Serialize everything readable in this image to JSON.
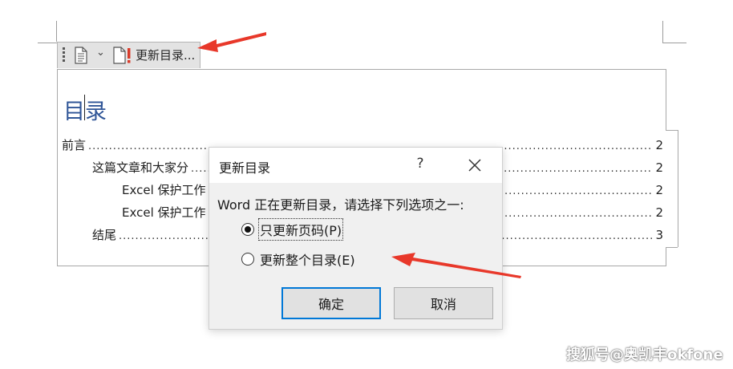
{
  "toolbar": {
    "update_label": "更新目录...",
    "chevron": "⌄",
    "icons": [
      "grip-icon",
      "document-icon",
      "update-document-icon"
    ]
  },
  "toc": {
    "title": "目录",
    "entries": [
      {
        "text": "前言",
        "page": "2"
      },
      {
        "text": "这篇文章和大家分",
        "page": "2"
      },
      {
        "text": "Excel 保护工作",
        "page": "2"
      },
      {
        "text": "Excel 保护工作",
        "page": "2"
      },
      {
        "text": "结尾",
        "page": "3"
      }
    ],
    "leader": "....................................................................................................................................................................................................."
  },
  "dialog": {
    "title": "更新目录",
    "help": "?",
    "message": "Word 正在更新目录，请选择下列选项之一:",
    "options": [
      {
        "label": "只更新页码(P)",
        "selected": true
      },
      {
        "label": "更新整个目录(E)",
        "selected": false
      }
    ],
    "ok_label": "确定",
    "cancel_label": "取消"
  },
  "colors": {
    "heading": "#2f5597",
    "arrow": "#e8382a",
    "focus_border": "#0078d7"
  },
  "watermark": "搜狐号@奥凯丰okfone"
}
